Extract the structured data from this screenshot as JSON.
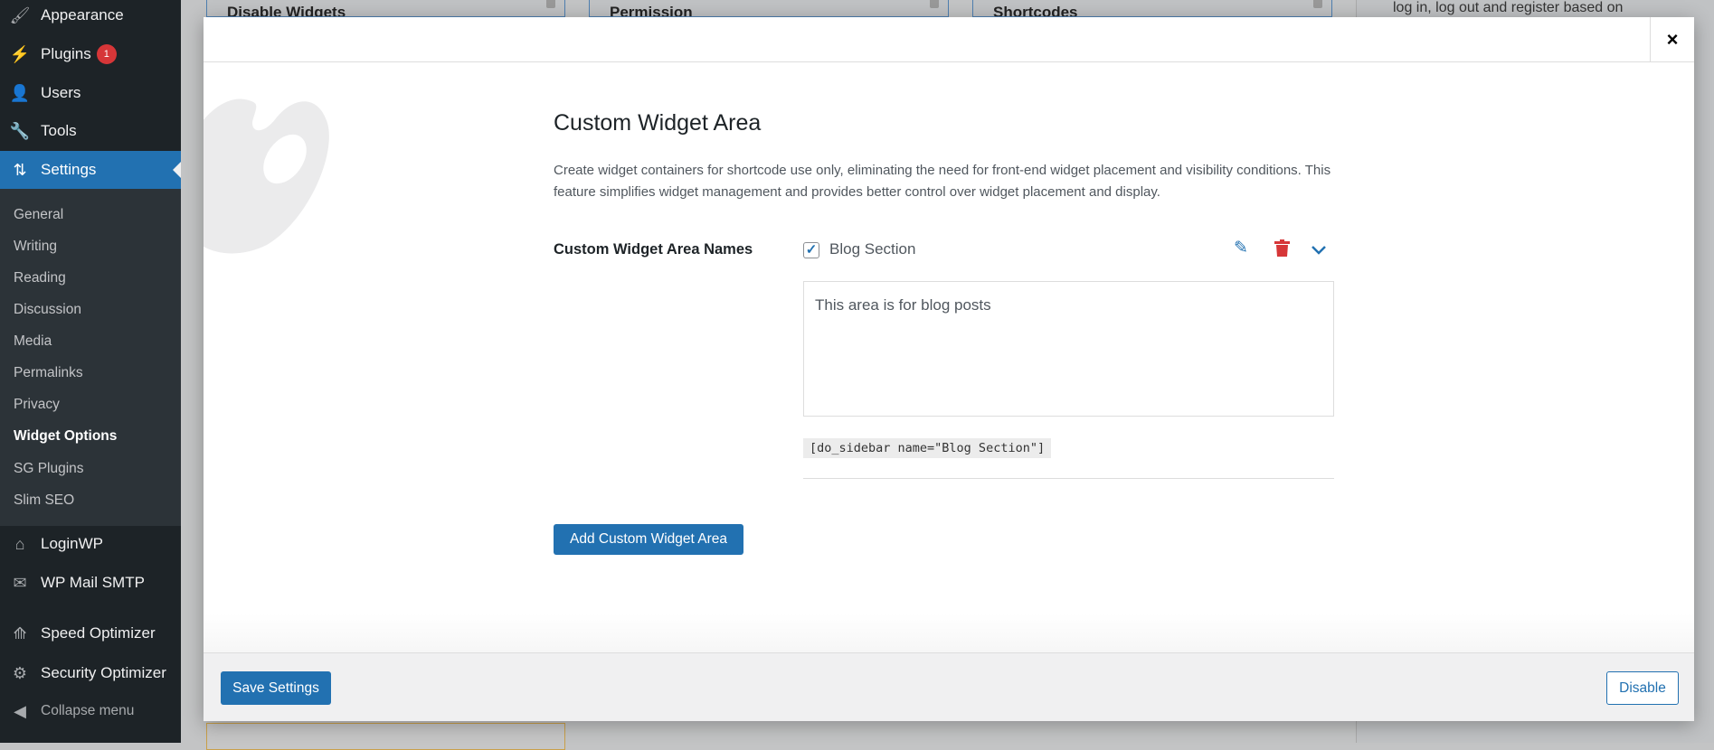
{
  "sidebar": {
    "items": [
      {
        "label": "Appearance",
        "icon": "paintbrush-icon"
      },
      {
        "label": "Plugins",
        "icon": "plug-icon",
        "badge": "1"
      },
      {
        "label": "Users",
        "icon": "user-icon"
      },
      {
        "label": "Tools",
        "icon": "wrench-icon"
      },
      {
        "label": "Settings",
        "icon": "settings-icon"
      }
    ],
    "submenu": [
      "General",
      "Writing",
      "Reading",
      "Discussion",
      "Media",
      "Permalinks",
      "Privacy",
      "Widget Options",
      "SG Plugins",
      "Slim SEO"
    ],
    "items2": [
      {
        "label": "LoginWP",
        "icon": "home-icon"
      },
      {
        "label": "WP Mail SMTP",
        "icon": "mail-icon"
      },
      {
        "label": "Speed Optimizer",
        "icon": "rocket-icon"
      },
      {
        "label": "Security Optimizer",
        "icon": "gear-lock-icon"
      }
    ],
    "collapse": "Collapse menu"
  },
  "background": {
    "cards": [
      "Disable Widgets",
      "Permission",
      "Shortcodes"
    ],
    "right_text": "log in, log out and register based on"
  },
  "modal": {
    "close": "×",
    "title": "Custom Widget Area",
    "description": "Create widget containers for shortcode use only, eliminating the need for front-end widget placement and visibility conditions. This feature simplifies widget management and provides better control over widget placement and display.",
    "field_label": "Custom Widget Area Names",
    "area": {
      "name": "Blog Section",
      "checked": true,
      "description": "This area is for blog posts",
      "shortcode": "[do_sidebar name=\"Blog Section\"]"
    },
    "add_button": "Add Custom Widget Area",
    "save_button": "Save Settings",
    "disable_button": "Disable"
  },
  "colors": {
    "accent": "#2271b1",
    "danger": "#d63638",
    "sidebar": "#1d2327"
  }
}
